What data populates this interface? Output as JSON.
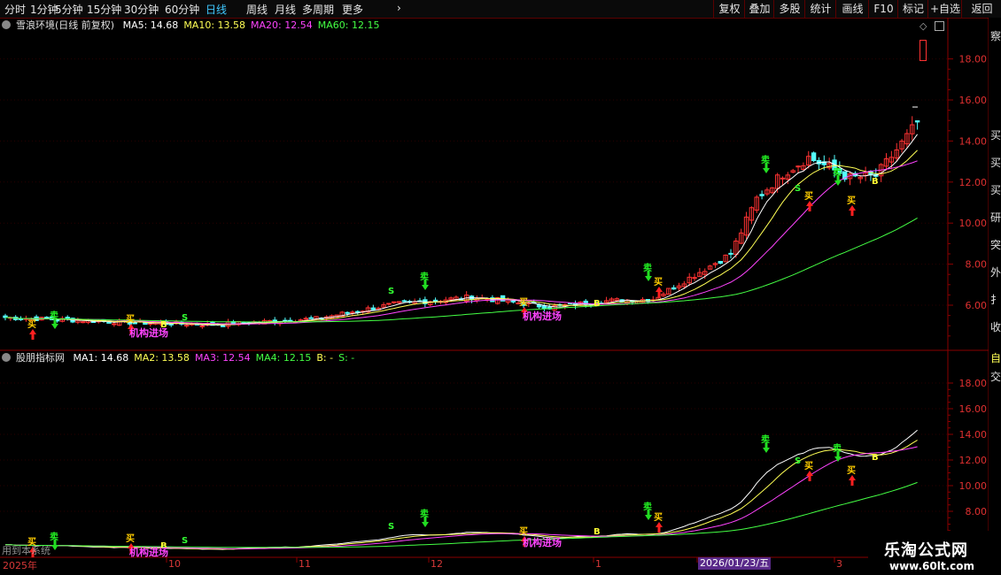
{
  "toolbar": {
    "left_items": [
      "分时",
      "1分钟",
      "5分钟",
      "15分钟",
      "30分钟",
      "60分钟",
      "日线",
      "周线",
      "月线",
      "多周期",
      "更多"
    ],
    "active_index": 6,
    "more_arrow": "›",
    "right_items": [
      "复权",
      "叠加",
      "多股",
      "统计",
      "画线",
      "F10",
      "标记",
      "+自选",
      "返回"
    ]
  },
  "main_panel": {
    "title": "雪浪环境(日线 前复权)",
    "ma_labels": [
      {
        "text": "MA5: 14.68",
        "color": "#ffffff"
      },
      {
        "text": "MA10: 13.58",
        "color": "#ffff55"
      },
      {
        "text": "MA20: 12.54",
        "color": "#ff44ff"
      },
      {
        "text": "MA60: 12.15",
        "color": "#44ff44"
      }
    ],
    "y_ticks": [
      "18.00",
      "16.00",
      "14.00",
      "12.00",
      "10.00",
      "8.00",
      "6.00"
    ],
    "signal_text": "机构进场"
  },
  "indicator_panel": {
    "title": "股朋指标网",
    "ma_labels": [
      {
        "text": "MA1: 14.68",
        "color": "#ffffff"
      },
      {
        "text": "MA2: 13.58",
        "color": "#ffff55"
      },
      {
        "text": "MA3: 12.54",
        "color": "#ff44ff"
      },
      {
        "text": "MA4: 12.15",
        "color": "#44ff44"
      },
      {
        "text": "B: -",
        "color": "#ffff55"
      },
      {
        "text": "S: -",
        "color": "#44ff44"
      }
    ],
    "y_ticks": [
      "18.00",
      "16.00",
      "14.00",
      "12.00",
      "10.00",
      "8.00"
    ],
    "signal_text": "机构进场",
    "bottom_text": "用到本系统"
  },
  "date_axis": {
    "labels": [
      "2025年",
      "10",
      "11",
      "12",
      "1",
      "3"
    ],
    "cursor_label": "2026/01/23/五"
  },
  "markers": {
    "buy": "买",
    "sell": "卖",
    "b": "B",
    "s": "S"
  },
  "right_strip": {
    "top": "察",
    "chars": [
      "买",
      "买",
      "买",
      "研",
      "突",
      "外",
      "扌",
      "收"
    ],
    "mid": "自",
    "low": "交"
  },
  "watermark": {
    "line1": "乐淘公式网",
    "line2": "www.60lt.com"
  },
  "colors": {
    "up": "#ff3232",
    "down": "#54ffff",
    "grid": "#8a0000",
    "ma5": "#ffffff",
    "ma10": "#ffff55",
    "ma20": "#ff44ff",
    "ma60": "#44ff44"
  }
}
